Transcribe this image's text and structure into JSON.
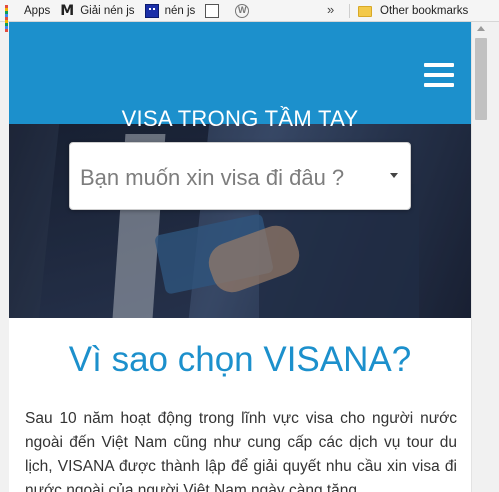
{
  "bookmarks": {
    "items": [
      {
        "label": "Apps",
        "icon": "apps-grid-icon"
      },
      {
        "label": "Giải nén js",
        "icon": "gmail-m-icon"
      },
      {
        "label": "nén js",
        "icon": "dotted-square-icon"
      },
      {
        "label": "",
        "icon": "page-icon"
      },
      {
        "label": "",
        "icon": "wordpress-icon"
      }
    ],
    "overflow": "»",
    "other": "Other bookmarks"
  },
  "site": {
    "title": "VISA TRONG TẦM TAY",
    "search_placeholder": "Bạn muốn xin visa đi đâu ?",
    "why_heading": "Vì sao chọn VISANA?",
    "intro_text": "Sau 10 năm hoạt động trong lĩnh vực visa cho người nước ngoài đến Việt Nam cũng như cung cấp các dịch vụ tour du lịch, VISANA được thành lập để giải quyết nhu cầu xin visa đi nước ngoài của người Việt Nam ngày càng tăng."
  },
  "colors": {
    "brand_blue": "#1c90cc",
    "text": "#333333"
  }
}
